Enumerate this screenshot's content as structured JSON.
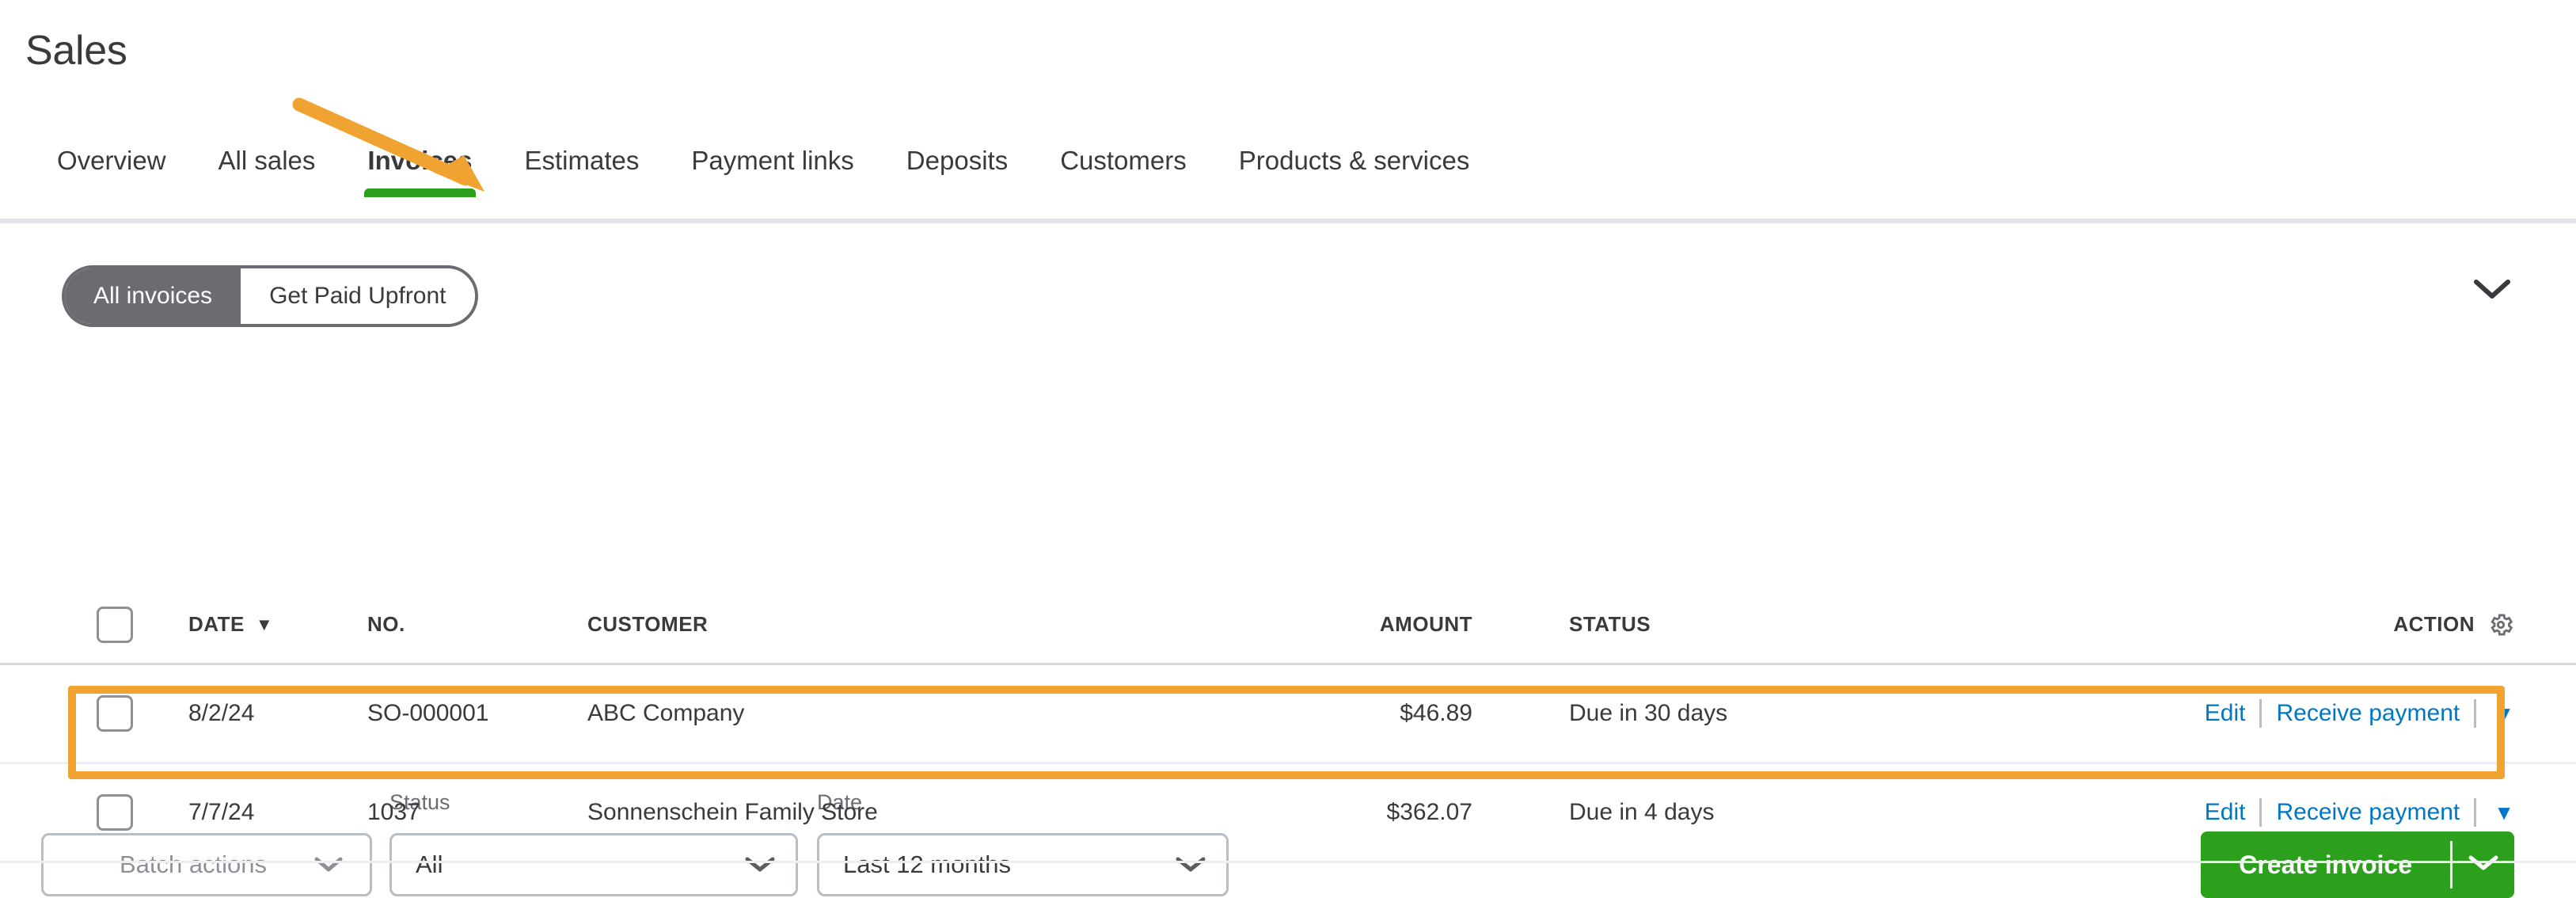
{
  "header": {
    "page_title": "Sales"
  },
  "tabs": [
    {
      "label": "Overview",
      "active": false
    },
    {
      "label": "All sales",
      "active": false
    },
    {
      "label": "Invoices",
      "active": true
    },
    {
      "label": "Estimates",
      "active": false
    },
    {
      "label": "Payment links",
      "active": false
    },
    {
      "label": "Deposits",
      "active": false
    },
    {
      "label": "Customers",
      "active": false
    },
    {
      "label": "Products & services",
      "active": false
    }
  ],
  "toggle": {
    "selected_label": "All invoices",
    "unselected_label": "Get Paid Upfront"
  },
  "collapse": {
    "icon": "chevron-down-icon"
  },
  "filters": {
    "batch_actions_label": "Batch actions",
    "status_label": "Status",
    "status_value": "All",
    "date_label": "Date",
    "date_value": "Last 12 months"
  },
  "create": {
    "label": "Create invoice",
    "dropdown_icon": "chevron-down-icon",
    "color": "#2ca01c"
  },
  "table": {
    "columns": {
      "date": "DATE",
      "date_sort_caret": "▼",
      "no": "NO.",
      "customer": "CUSTOMER",
      "amount": "AMOUNT",
      "status": "STATUS",
      "action": "ACTION"
    },
    "rows": [
      {
        "date": "8/2/24",
        "no": "SO-000001",
        "customer": "ABC Company",
        "amount": "$46.89",
        "status": "Due in 30 days",
        "edit_label": "Edit",
        "receive_label": "Receive payment",
        "caret": "▼",
        "highlighted": true
      },
      {
        "date": "7/7/24",
        "no": "1037",
        "customer": "Sonnenschein Family Store",
        "amount": "$362.07",
        "status": "Due in 4 days",
        "edit_label": "Edit",
        "receive_label": "Receive payment",
        "caret": "▼",
        "highlighted": false
      }
    ]
  },
  "annotations": {
    "arrow_color": "#f0a330",
    "highlight_color": "#f0a330",
    "arrow_points_to": "Invoices",
    "highlight_targets_row": "8/2/24 SO-000001 ABC Company"
  }
}
